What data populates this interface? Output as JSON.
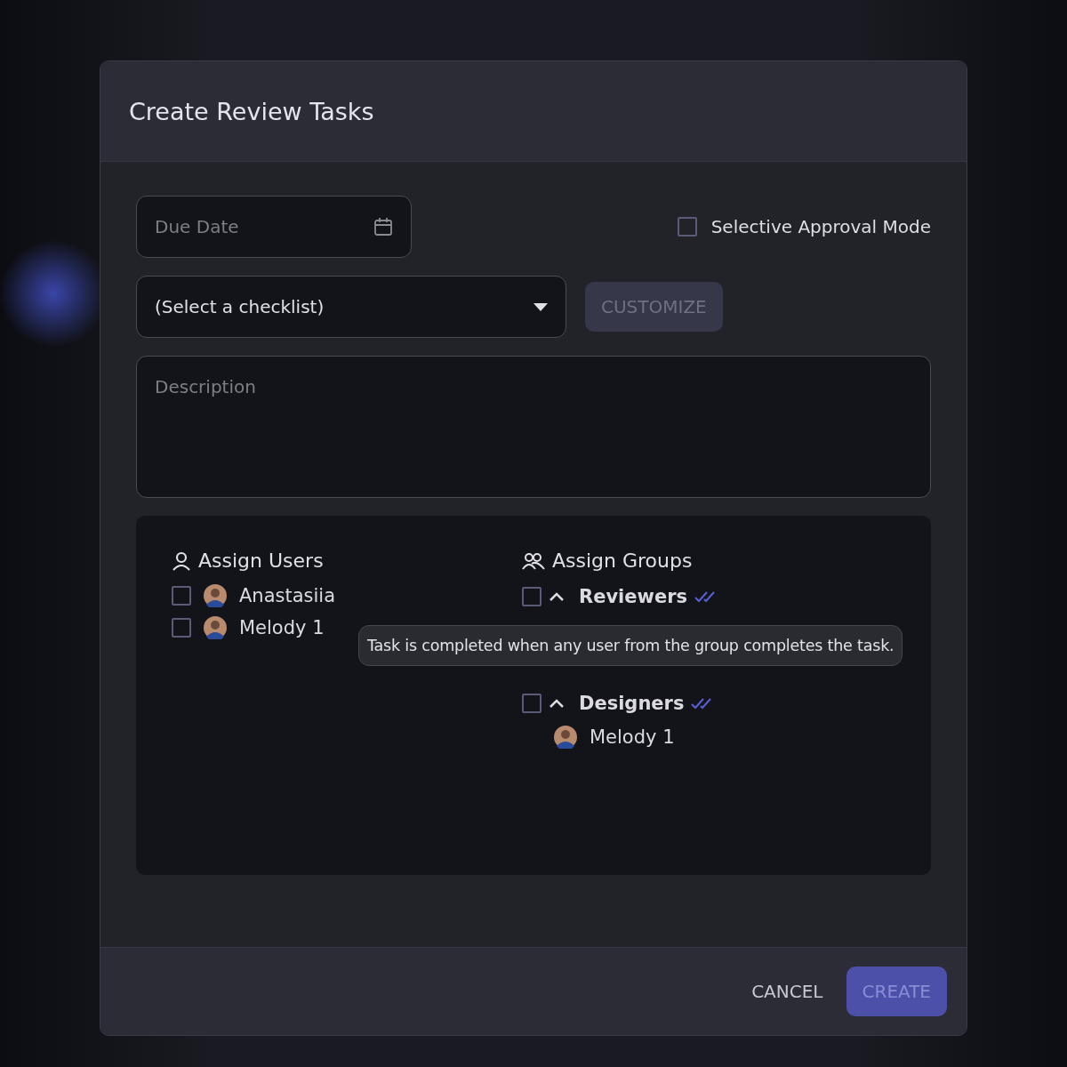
{
  "dialog": {
    "title": "Create Review Tasks"
  },
  "due_date": {
    "placeholder": "Due Date"
  },
  "selective_approval": {
    "label": "Selective Approval Mode",
    "checked": false
  },
  "checklist": {
    "value": "(Select a checklist)"
  },
  "customize_button": {
    "label": "CUSTOMIZE",
    "disabled": true
  },
  "description": {
    "placeholder": "Description"
  },
  "assign_users": {
    "title": "Assign Users",
    "users": [
      {
        "name": "Anastasiia",
        "checked": false
      },
      {
        "name": "Melody 1",
        "checked": false
      }
    ]
  },
  "assign_groups": {
    "title": "Assign Groups",
    "groups": [
      {
        "name": "Reviewers",
        "checked": false,
        "expanded": true
      },
      {
        "name": "Designers",
        "checked": false,
        "expanded": true,
        "members": [
          {
            "name": "Melody 1"
          }
        ]
      }
    ]
  },
  "tooltip": {
    "text": "Task is completed when any user from the group completes the task."
  },
  "footer": {
    "cancel": "CANCEL",
    "create": {
      "label": "CREATE",
      "disabled": true
    }
  }
}
